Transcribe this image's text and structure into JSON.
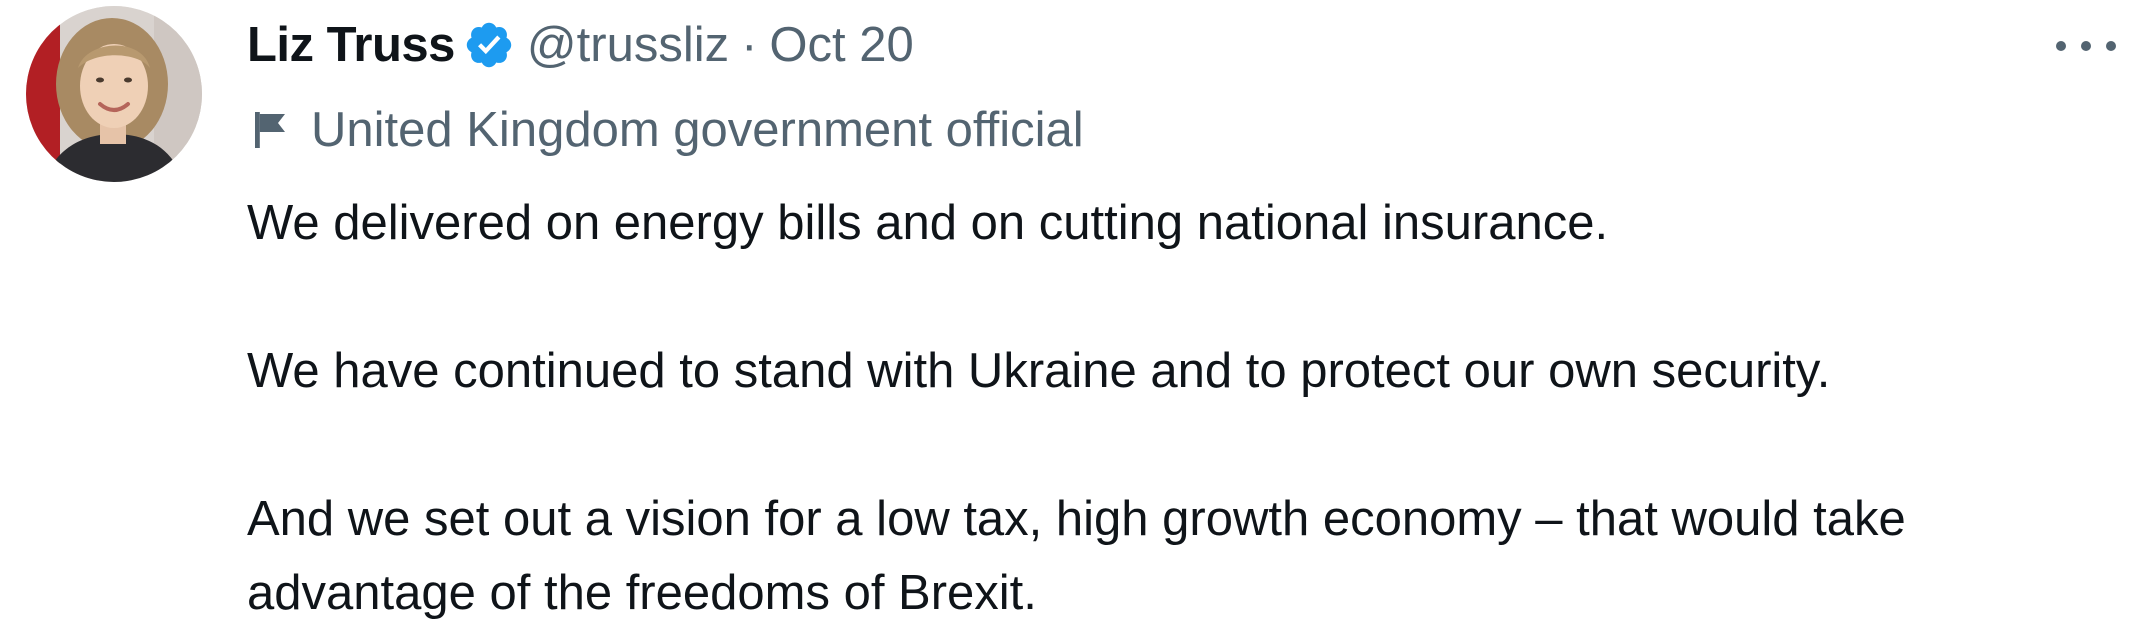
{
  "tweet": {
    "author": {
      "display_name": "Liz Truss",
      "handle": "@trussliz",
      "verified": true,
      "avatar_icon": "profile-photo-avatar"
    },
    "separator": "·",
    "date": "Oct 20",
    "affiliation_label": "United Kingdom government official",
    "affiliation_icon": "flag-icon",
    "paragraphs": [
      "We delivered on energy bills and on cutting national insurance.",
      "We have continued to stand with Ukraine and to protect our own security.",
      "And we set out a vision for a low tax, high growth economy – that would take advantage of the freedoms of Brexit."
    ],
    "more_icon": "more-options-icon"
  },
  "colors": {
    "primary_text": "#0f1419",
    "secondary_text": "#536471",
    "verified_blue": "#1d9bf0"
  }
}
